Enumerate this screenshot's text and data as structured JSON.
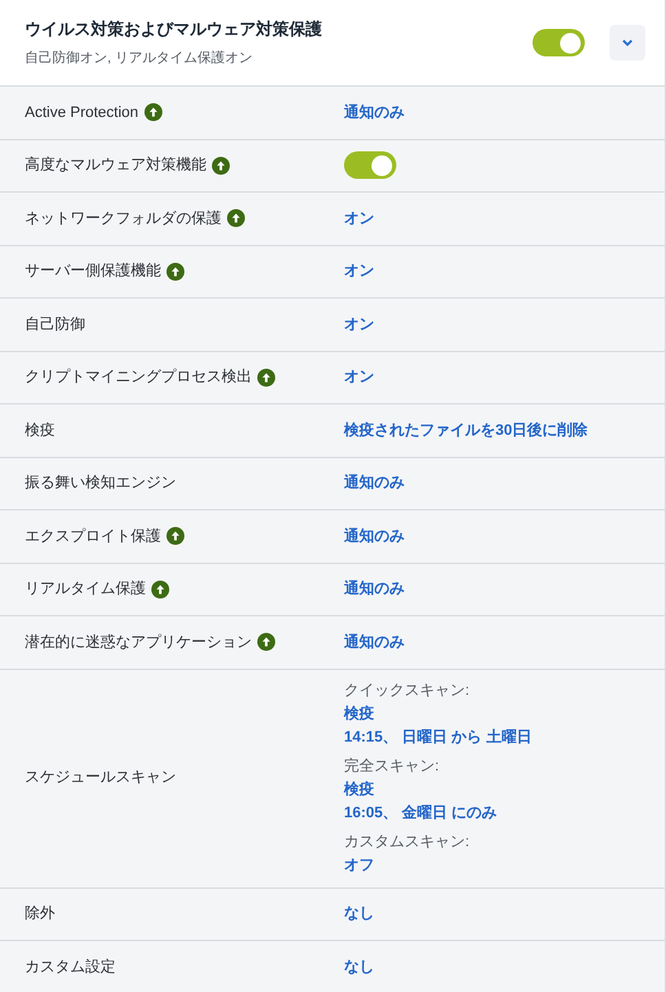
{
  "header": {
    "title": "ウイルス対策およびマルウェア対策保護",
    "subtitle": "自己防御オン, リアルタイム保護オン",
    "on": true,
    "expanded": true
  },
  "rows": [
    {
      "kind": "link",
      "label": "Active Protection",
      "upgrade": true,
      "value": "通知のみ"
    },
    {
      "kind": "toggle",
      "label": "高度なマルウェア対策機能",
      "upgrade": true,
      "on": true
    },
    {
      "kind": "link",
      "label": "ネットワークフォルダの保護",
      "upgrade": true,
      "value": "オン"
    },
    {
      "kind": "link",
      "label": "サーバー側保護機能",
      "upgrade": true,
      "value": "オン"
    },
    {
      "kind": "link",
      "label": "自己防御",
      "upgrade": false,
      "value": "オン"
    },
    {
      "kind": "link",
      "label": "クリプトマイニングプロセス検出",
      "upgrade": true,
      "value": "オン"
    },
    {
      "kind": "link",
      "label": "検疫",
      "upgrade": false,
      "value": "検疫されたファイルを30日後に削除"
    },
    {
      "kind": "link",
      "label": "振る舞い検知エンジン",
      "upgrade": false,
      "value": "通知のみ"
    },
    {
      "kind": "link",
      "label": "エクスプロイト保護",
      "upgrade": true,
      "value": "通知のみ"
    },
    {
      "kind": "link",
      "label": "リアルタイム保護",
      "upgrade": true,
      "value": "通知のみ"
    },
    {
      "kind": "link",
      "label": "潜在的に迷惑なアプリケーション",
      "upgrade": true,
      "value": "通知のみ"
    },
    {
      "kind": "schedule",
      "label": "スケジュールスキャン",
      "upgrade": false,
      "scans": [
        {
          "label": "クイックスキャン:",
          "lines": [
            "検疫",
            "14:15、 日曜日 から 土曜日"
          ]
        },
        {
          "label": "完全スキャン:",
          "lines": [
            "検疫",
            "16:05、 金曜日 にのみ"
          ]
        },
        {
          "label": "カスタムスキャン:",
          "lines": [
            "オフ"
          ]
        }
      ]
    },
    {
      "kind": "link",
      "label": "除外",
      "upgrade": false,
      "value": "なし"
    },
    {
      "kind": "link",
      "label": "カスタム設定",
      "upgrade": false,
      "value": "なし"
    }
  ]
}
